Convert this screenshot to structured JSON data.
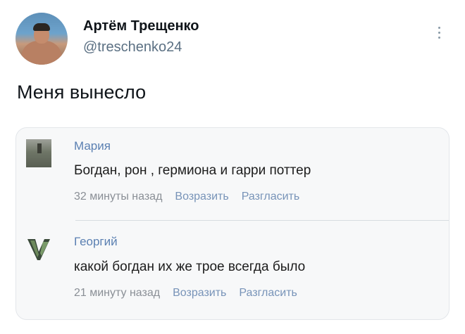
{
  "tweet": {
    "author_name": "Артём Трещенко",
    "author_handle": "@treschenko24",
    "text": "Меня вынесло"
  },
  "embedded_comments": [
    {
      "name": "Мария",
      "text": "Богдан, рон , гермиона и гарри поттер",
      "time": "32 минуты назад",
      "action1": "Возразить",
      "action2": "Разгласить"
    },
    {
      "name": "Георгий",
      "text": "какой богдан их же трое всегда было",
      "time": "21 минуту назад",
      "action1": "Возразить",
      "action2": "Разгласить"
    }
  ],
  "colors": {
    "handle": "#5b7083",
    "comment_name": "#5b80b2",
    "comment_meta": "#8a8f96"
  }
}
